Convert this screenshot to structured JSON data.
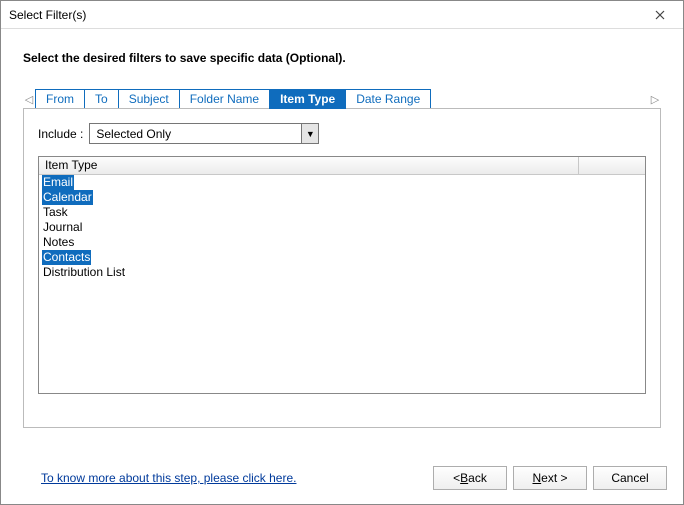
{
  "window": {
    "title": "Select Filter(s)"
  },
  "instruction": "Select the desired filters to save specific data (Optional).",
  "tabs": {
    "items": [
      {
        "label": "From",
        "active": false
      },
      {
        "label": "To",
        "active": false
      },
      {
        "label": "Subject",
        "active": false
      },
      {
        "label": "Folder Name",
        "active": false
      },
      {
        "label": "Item Type",
        "active": true
      },
      {
        "label": "Date Range",
        "active": false
      }
    ]
  },
  "include": {
    "label": "Include :",
    "value": "Selected Only"
  },
  "list": {
    "header": "Item Type",
    "items": [
      {
        "label": "Email",
        "selected": true
      },
      {
        "label": "Calendar",
        "selected": true
      },
      {
        "label": "Task",
        "selected": false
      },
      {
        "label": "Journal",
        "selected": false
      },
      {
        "label": "Notes",
        "selected": false
      },
      {
        "label": "Contacts",
        "selected": true
      },
      {
        "label": "Distribution List",
        "selected": false
      }
    ]
  },
  "help_link": "To know more about this step, please click here.",
  "buttons": {
    "back_prefix": "< ",
    "back_mn": "B",
    "back_suffix": "ack",
    "next_mn": "N",
    "next_suffix": "ext >",
    "cancel": "Cancel"
  }
}
